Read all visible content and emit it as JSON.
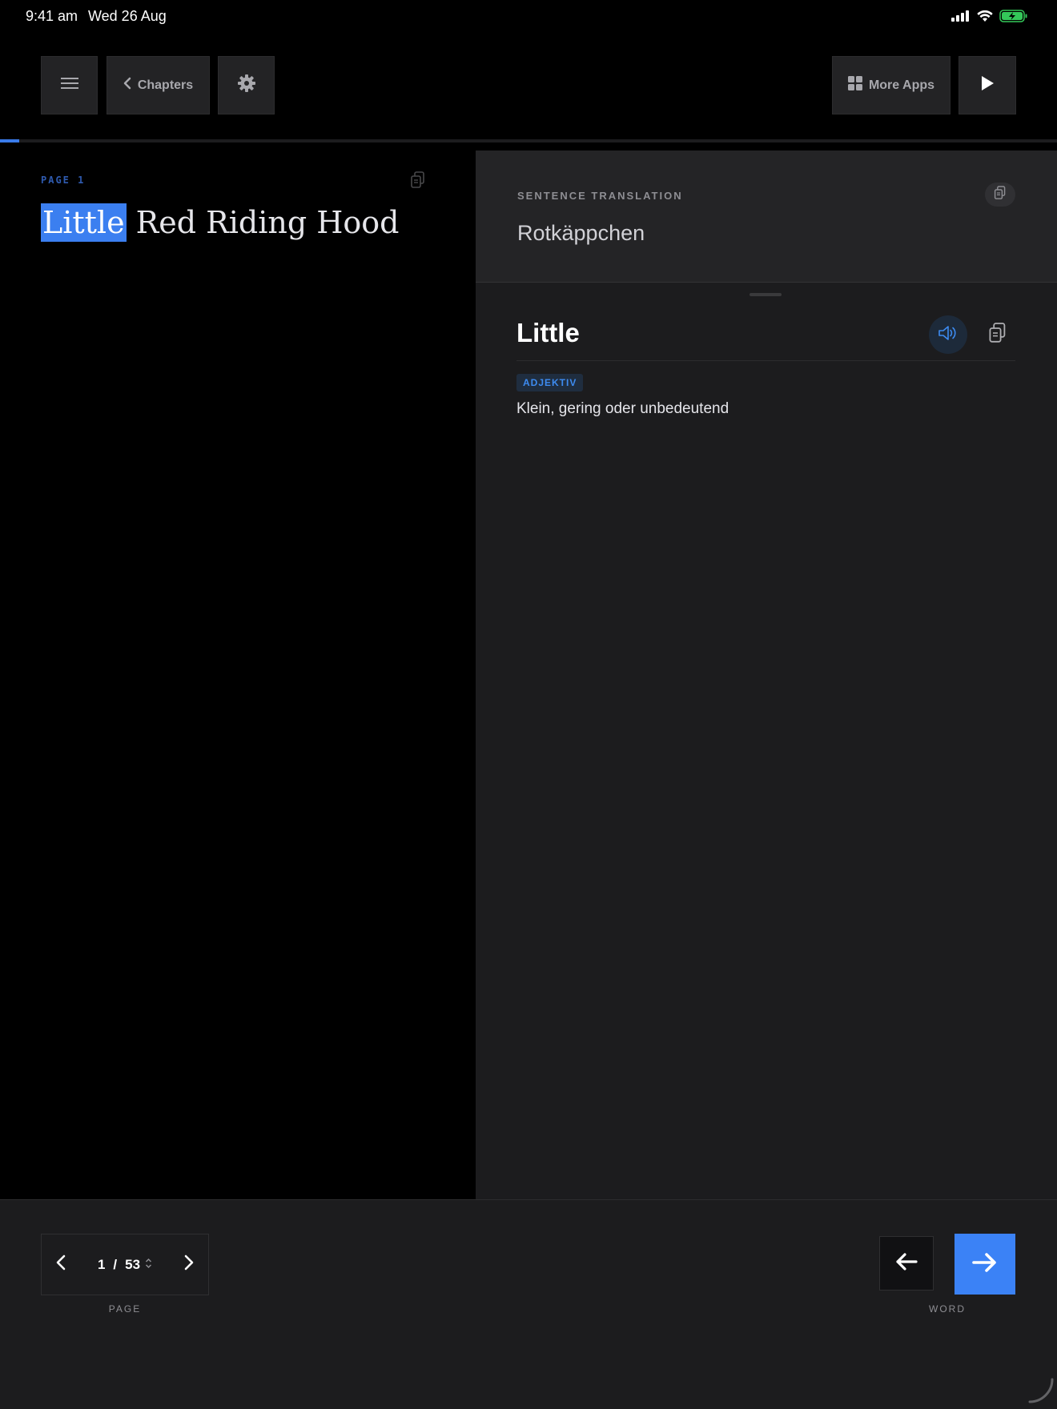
{
  "status_bar": {
    "time": "9:41 am",
    "date": "Wed 26 Aug"
  },
  "toolbar": {
    "chapters_label": "Chapters",
    "more_apps_label": "More Apps"
  },
  "reading": {
    "page_label": "PAGE 1",
    "highlighted_word": "Little",
    "rest_text": " Red Riding Hood",
    "progress_fraction": 0.018
  },
  "translation": {
    "label": "SENTENCE TRANSLATION",
    "text": "Rotkäppchen"
  },
  "word": {
    "title": "Little",
    "part_of_speech": "ADJEKTIV",
    "definition": "Klein, gering oder unbedeutend"
  },
  "pager": {
    "current": "1",
    "separator": "/",
    "total": "53",
    "label": "PAGE"
  },
  "word_nav": {
    "label": "WORD"
  },
  "colors": {
    "accent": "#3b82f6",
    "panel": "#1c1c1e",
    "battery": "#34c759"
  }
}
